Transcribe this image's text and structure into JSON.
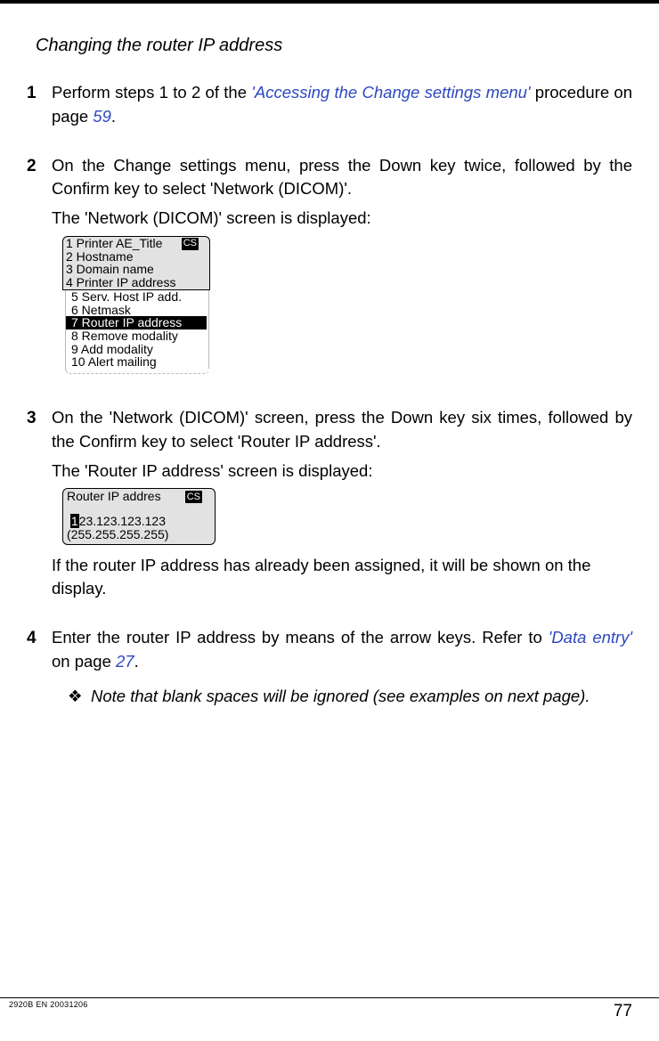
{
  "heading": "Changing the router IP address",
  "steps": {
    "s1": {
      "num": "1",
      "pre": "Perform steps 1 to 2 of the ",
      "link": "'Accessing the Change settings menu'",
      "post": " procedure on page ",
      "pageref": "59",
      "tail": "."
    },
    "s2": {
      "num": "2",
      "p1": "On the Change settings menu, press the Down key twice, followed by the Confirm key to select 'Network (DICOM)'.",
      "p2": "The 'Network (DICOM)' screen is displayed:"
    },
    "s3": {
      "num": "3",
      "p1": "On the 'Network (DICOM)' screen, press the Down key six times, followed by the Confirm key to select 'Router IP address'.",
      "p2": "The 'Router IP address' screen is displayed:",
      "after": "If the router IP address has already been assigned, it will be shown on the display."
    },
    "s4": {
      "num": "4",
      "pre": "Enter the router IP address by means of the arrow keys. Refer to ",
      "link": "'Data entry'",
      "mid": " on page ",
      "pageref": "27",
      "tail": ".",
      "note": "Note that blank spaces will be ignored (see examples on next page)."
    }
  },
  "lcd1": {
    "cs": "CS",
    "r1": "1 Printer AE_Title",
    "r2": "2 Hostname",
    "r3": "3 Domain name",
    "r4": "4 Printer IP address",
    "r5": "5 Serv. Host IP add.",
    "r6": "6 Netmask",
    "r7": "7 Router IP address",
    "r8": "8 Remove modality",
    "r9": "9 Add modality",
    "r10": "10 Alert mailing"
  },
  "lcd2": {
    "cs": "CS",
    "title": "Router IP addres",
    "cursor": "1",
    "value_rest": "23.123.123.123",
    "mask": "(255.255.255.255)"
  },
  "footer": {
    "doc_id": "2920B EN 20031206",
    "page": "77"
  }
}
